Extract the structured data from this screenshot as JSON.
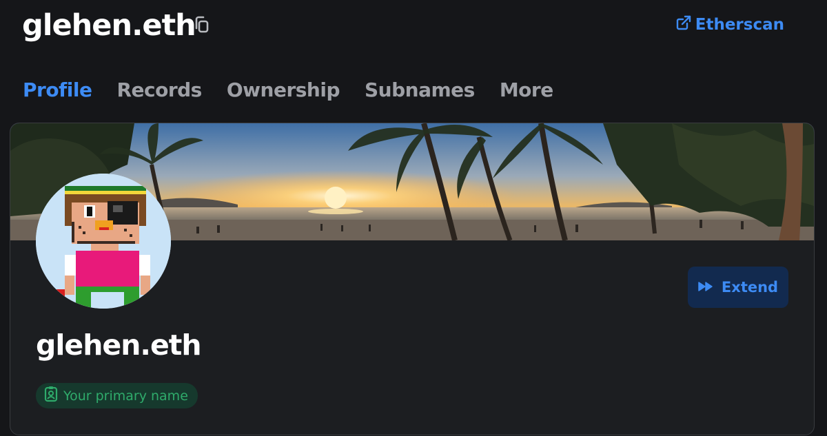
{
  "header": {
    "title": "glehen.eth",
    "copy_icon": "copy-icon",
    "etherscan_label": "Etherscan",
    "etherscan_icon": "external-link-icon"
  },
  "tabs": [
    {
      "label": "Profile",
      "active": true
    },
    {
      "label": "Records",
      "active": false
    },
    {
      "label": "Ownership",
      "active": false
    },
    {
      "label": "Subnames",
      "active": false
    },
    {
      "label": "More",
      "active": false
    }
  ],
  "profile": {
    "name": "glehen.eth",
    "primary_badge": "Your primary name",
    "primary_badge_icon": "id-badge-icon",
    "extend_label": "Extend",
    "extend_icon": "fast-forward-icon",
    "banner": "beach-sunset-palm-trees-image",
    "avatar": "pixel-art-pirate-avatar"
  },
  "colors": {
    "accent": "#3d8bf4",
    "background": "#151619",
    "card": "#1c1e21",
    "success": "#2fab6b",
    "success_bg": "#16392d",
    "extend_bg": "#122a4f"
  }
}
